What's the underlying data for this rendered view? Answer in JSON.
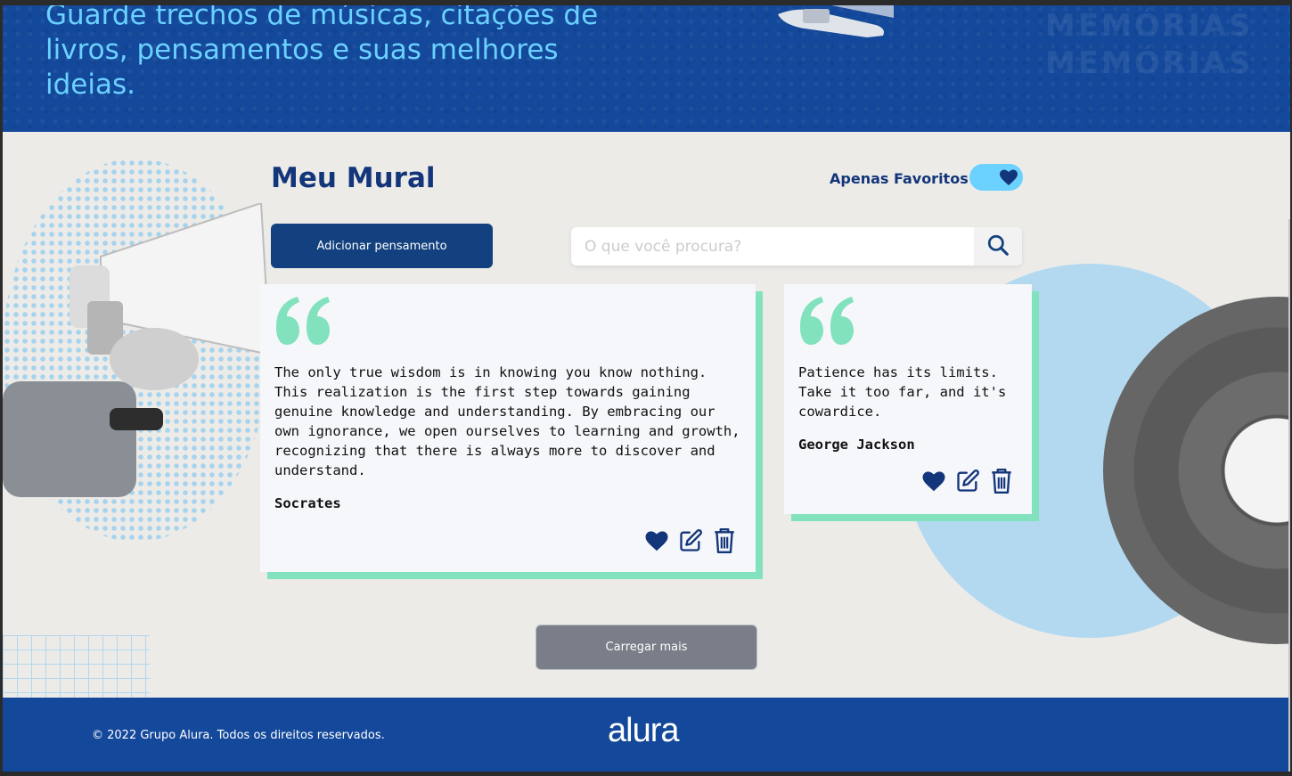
{
  "header": {
    "hero_text": "Guarde trechos de músicas, citações de livros, pensamentos e suas melhores ideias.",
    "watermark": "MEMÓRIAS"
  },
  "main": {
    "title": "Meu Mural",
    "favorites_label": "Apenas Favoritos",
    "add_button": "Adicionar pensamento",
    "search": {
      "placeholder": "O que você procura?",
      "value": ""
    },
    "cards": [
      {
        "quote": "The only true wisdom is in knowing you know nothing. This realization is the first step towards gaining genuine knowledge and understanding. By embracing our own ignorance, we open ourselves to learning and growth, recognizing that there is always more to discover and understand.",
        "author": "Socrates",
        "favorite": true
      },
      {
        "quote": "Patience has its limits. Take it too far, and it's cowardice.",
        "author": "George Jackson",
        "favorite": true
      }
    ],
    "load_more": "Carregar mais"
  },
  "footer": {
    "copyright": "© 2022 Grupo Alura. Todos os direitos reservados.",
    "logo": "alura"
  },
  "colors": {
    "brand_blue": "#13489a",
    "dark_blue": "#13357a",
    "accent_cyan": "#6bd1ff",
    "accent_green": "#82e2bd",
    "card_bg": "#f6f7fb"
  },
  "icons": {
    "quote": "quote-icon",
    "heart": "heart-icon",
    "edit": "edit-icon",
    "delete": "trash-icon",
    "search": "search-icon"
  }
}
